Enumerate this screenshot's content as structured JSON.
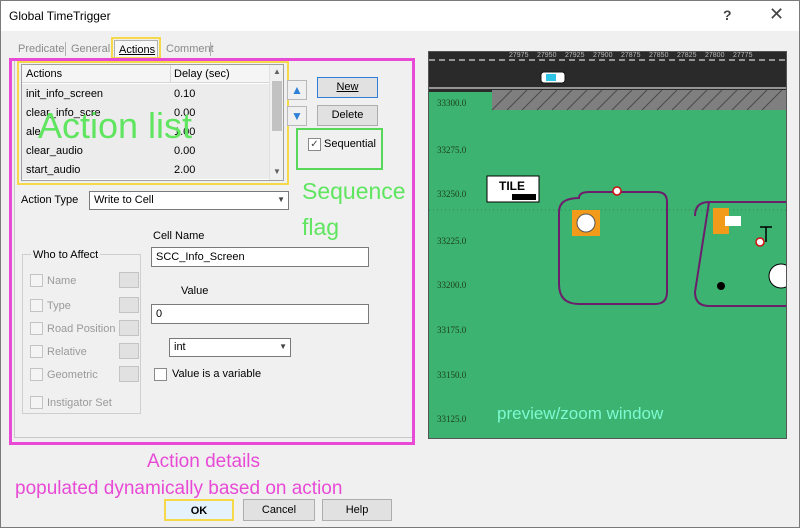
{
  "window": {
    "title": "Global TimeTrigger",
    "help_glyph": "?",
    "close_glyph": "✕"
  },
  "tabs": [
    {
      "label": "Predicate"
    },
    {
      "label": "General"
    },
    {
      "label": "Actions"
    },
    {
      "label": "Comment"
    }
  ],
  "action_list": {
    "headers": [
      "Actions",
      "Delay (sec)"
    ],
    "rows": [
      {
        "action": "init_info_screen",
        "delay": "0.10"
      },
      {
        "action": "clear_info_scre",
        "delay": "0.00"
      },
      {
        "action": "ale",
        "delay": "1.00"
      },
      {
        "action": "clear_audio",
        "delay": "0.00"
      },
      {
        "action": "start_audio",
        "delay": "2.00"
      }
    ]
  },
  "buttons": {
    "new": "New",
    "delete": "Delete",
    "ok": "OK",
    "cancel": "Cancel",
    "help": "Help"
  },
  "sequential": {
    "label": "Sequential",
    "checked": true,
    "check_glyph": "✓"
  },
  "action_type": {
    "label": "Action Type",
    "value": "Write to Cell"
  },
  "who_to_affect": {
    "title": "Who to Affect",
    "options": [
      "Name",
      "Type",
      "Road Position",
      "Relative",
      "Geometric",
      "Instigator Set"
    ]
  },
  "cell_name": {
    "label": "Cell Name",
    "value": "SCC_Info_Screen"
  },
  "value_field": {
    "label": "Value",
    "value": "0"
  },
  "value_type": {
    "value": "int"
  },
  "value_is_variable": {
    "label": "Value is a variable",
    "checked": false
  },
  "annotations": {
    "action_list": "Action list",
    "sequence_flag_1": "Sequence",
    "sequence_flag_2": "flag",
    "action_details_1": "Action details",
    "action_details_2": "populated dynamically based on action",
    "preview": "preview/zoom window"
  },
  "preview": {
    "ruler_ticks": [
      "27975",
      "27950",
      "27925",
      "27900",
      "27875",
      "27850",
      "27825",
      "27800",
      "27775"
    ],
    "y_ticks": [
      "33300.0",
      "33275.0",
      "33250.0",
      "33225.0",
      "33200.0",
      "33175.0",
      "33150.0",
      "33125.0"
    ],
    "tile_label": "TILE",
    "colors": {
      "ground": "#3cb371",
      "road": "#1e1e1e",
      "outline": "#6b1f6b",
      "label": "#7dfad0"
    }
  }
}
